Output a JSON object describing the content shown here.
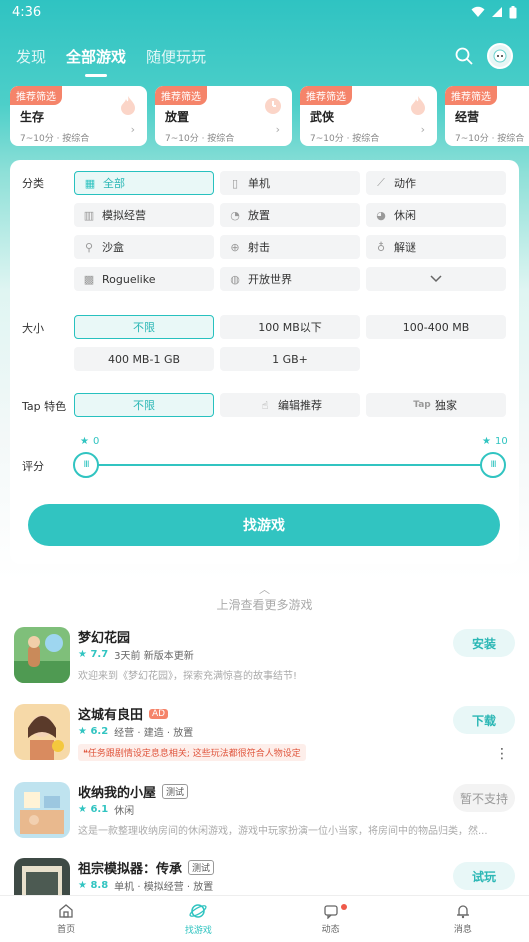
{
  "status": {
    "time": "4:36"
  },
  "top_nav": {
    "tabs": [
      "发现",
      "全部游戏",
      "随便玩玩"
    ],
    "active_index": 1
  },
  "presets": [
    {
      "tag": "推荐筛选",
      "name": "生存",
      "meta": "7~10分 · 按综合"
    },
    {
      "tag": "推荐筛选",
      "name": "放置",
      "meta": "7~10分 · 按综合"
    },
    {
      "tag": "推荐筛选",
      "name": "武侠",
      "meta": "7~10分 · 按综合"
    },
    {
      "tag": "推荐筛选",
      "name": "经营",
      "meta": "7~10分 · 按综合"
    }
  ],
  "filters": {
    "category_label": "分类",
    "categories": [
      "全部",
      "单机",
      "动作",
      "模拟经营",
      "放置",
      "休闲",
      "沙盒",
      "射击",
      "解谜",
      "Roguelike",
      "开放世界"
    ],
    "size_label": "大小",
    "sizes": [
      "不限",
      "100 MB以下",
      "100-400 MB",
      "400 MB-1 GB",
      "1 GB+"
    ],
    "tap_label": "Tap 特色",
    "tap_features": [
      "不限",
      "编辑推荐",
      "独家"
    ],
    "rating_label": "评分",
    "rating_min": "0",
    "rating_max": "10",
    "find_button": "找游戏"
  },
  "swipe_hint": "上滑查看更多游戏",
  "games": [
    {
      "title": "梦幻花园",
      "rating": "7.7",
      "meta": "3天前 新版本更新",
      "desc": "欢迎来到《梦幻花园》，探索充满惊喜的故事结节!",
      "button": "安装"
    },
    {
      "title": "这城有良田",
      "badge": "AD",
      "rating": "6.2",
      "meta": "经营 · 建造 · 放置",
      "warn": "任务跟剧情设定息息相关; 这些玩法都很符合人物设定",
      "button": "下载"
    },
    {
      "title": "收纳我的小屋",
      "badge": "测试",
      "rating": "6.1",
      "meta": "休闲",
      "desc": "这是一款整理收纳房间的休闲游戏，游戏中玩家扮演一位小当家，将房间中的物品归类，然...",
      "button": "暂不支持"
    },
    {
      "title": "祖宗模拟器：传承",
      "badge": "测试",
      "rating": "8.8",
      "meta": "单机 · 模拟经营 · 放置",
      "button": "试玩"
    }
  ],
  "bottom_nav": [
    "首页",
    "找游戏",
    "动态",
    "消息"
  ],
  "colors": {
    "accent": "#31c4c1",
    "tag": "#f5846a"
  }
}
